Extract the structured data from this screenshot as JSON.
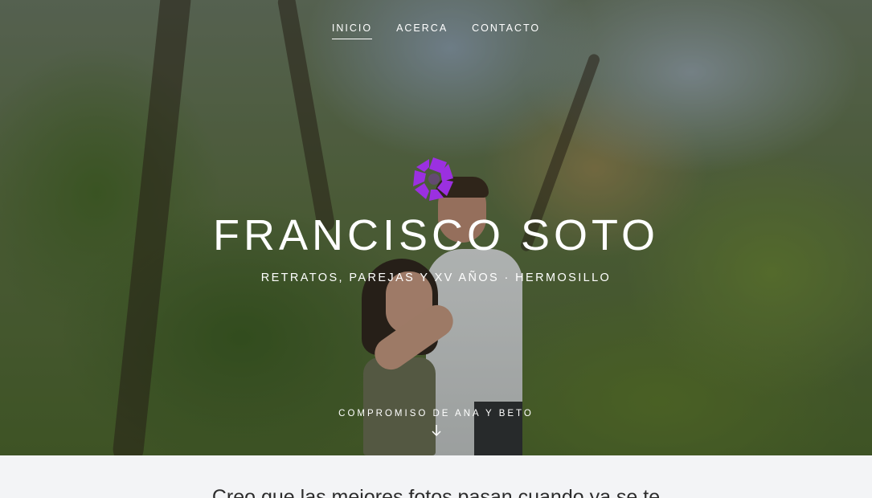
{
  "nav": {
    "items": [
      {
        "label": "INICIO",
        "active": true
      },
      {
        "label": "ACERCA",
        "active": false
      },
      {
        "label": "CONTACTO",
        "active": false
      }
    ]
  },
  "hero": {
    "title": "FRANCISCO SOTO",
    "subtitle": "RETRATOS, PAREJAS Y XV AÑOS · HERMOSILLO",
    "caption": "COMPROMISO DE ANA Y BETO",
    "scroll_icon": "arrow-down-icon",
    "logo_icon": "camera-shutter-logo",
    "logo_color": "#9b30e0"
  },
  "intro": {
    "text": "Creo que las mejores fotos pasan cuando ya se te"
  }
}
